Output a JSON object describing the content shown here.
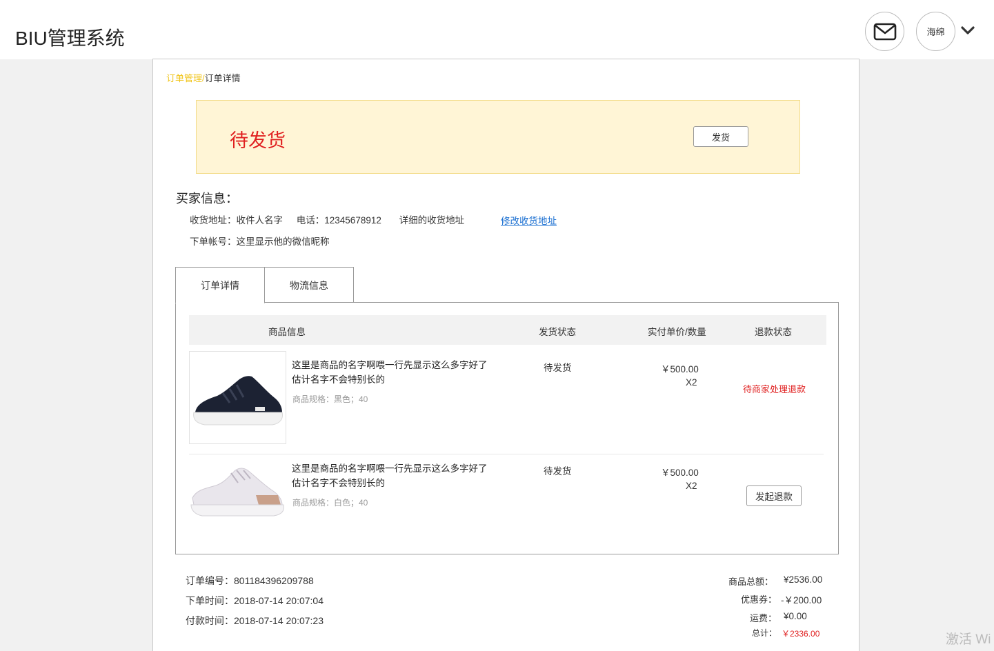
{
  "header": {
    "app_title": "BIU管理系统",
    "mail_icon": "mail-icon",
    "user_name": "海绵",
    "dropdown_icon": "chevron-down-icon"
  },
  "breadcrumb": {
    "parent": "订单管理",
    "separator": "/",
    "current": "订单详情"
  },
  "status": {
    "label": "待发货",
    "ship_button": "发货",
    "status_color": "#e02020",
    "box_color": "#fff5d6"
  },
  "buyer": {
    "title": "买家信息：",
    "address_label": "收货地址：收件人名字",
    "phone": "电话：12345678912",
    "detail_address": "详细的收货地址",
    "edit_address_link": "修改收货地址",
    "account": "下单帐号：这里显示他的微信昵称"
  },
  "tabs": [
    {
      "label": "订单详情",
      "active": true
    },
    {
      "label": "物流信息",
      "active": false
    }
  ],
  "table": {
    "headers": [
      "商品信息",
      "发货状态",
      "实付单价/数量",
      "退款状态"
    ],
    "rows": [
      {
        "image": "black-sneaker-image",
        "name": "这里是商品的名字啊喂一行先显示这么多字好了估计名字不会特别长的",
        "spec": "商品规格：黑色；40",
        "ship_status": "待发货",
        "price": "￥500.00",
        "qty": "X2",
        "refund_status": "待商家处理退款"
      },
      {
        "image": "white-sneaker-image",
        "name": "这里是商品的名字啊喂一行先显示这么多字好了估计名字不会特别长的",
        "spec": "商品规格：白色；40",
        "ship_status": "待发货",
        "price": "￥500.00",
        "qty": "X2",
        "refund_button": "发起退款"
      }
    ]
  },
  "order_meta": {
    "order_no": "订单编号：801184396209788",
    "order_time": "下单时间：2018-07-14 20:07:04",
    "pay_time": "付款时间：2018-07-14 20:07:23"
  },
  "summary": {
    "goods_total_label": "商品总额：",
    "goods_total": "¥2536.00",
    "coupon_label": "优惠券：",
    "coupon": "-￥200.00",
    "shipping_label": "运费：",
    "shipping": "¥0.00",
    "total_label": "总计：",
    "total": "￥2336.00"
  },
  "watermark": "激活 Wi"
}
